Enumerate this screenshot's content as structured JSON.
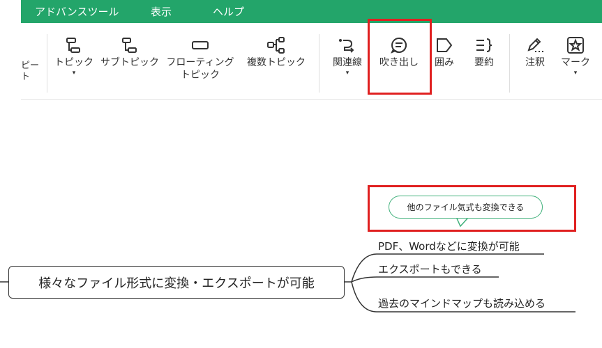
{
  "menu": {
    "items": [
      "アドバンスツール",
      "表示",
      "ヘルプ"
    ]
  },
  "toolbar": {
    "cut_label_top": "ピー",
    "cut_label_bottom": "ト",
    "topic": "トピック",
    "subtopic": "サブトピック",
    "floating_line1": "フローティング",
    "floating_line2": "トピック",
    "multiple": "複数トピック",
    "relation": "関連線",
    "callout": "吹き出し",
    "boundary": "囲み",
    "summary": "要約",
    "note": "注釈",
    "mark": "マーク",
    "caret": "▾"
  },
  "mindmap": {
    "main_topic": "様々なファイル形式に変換・エクスポートが可能",
    "subtopics": [
      "PDF、Wordなどに変換が可能",
      "エクスポートもできる",
      "過去のマインドマップも読み込める"
    ],
    "callout_text": "他のファイル気式も変換できる"
  },
  "colors": {
    "menu_bg": "#23a56a",
    "highlight": "#e02020",
    "callout_border": "#3fb07a"
  }
}
